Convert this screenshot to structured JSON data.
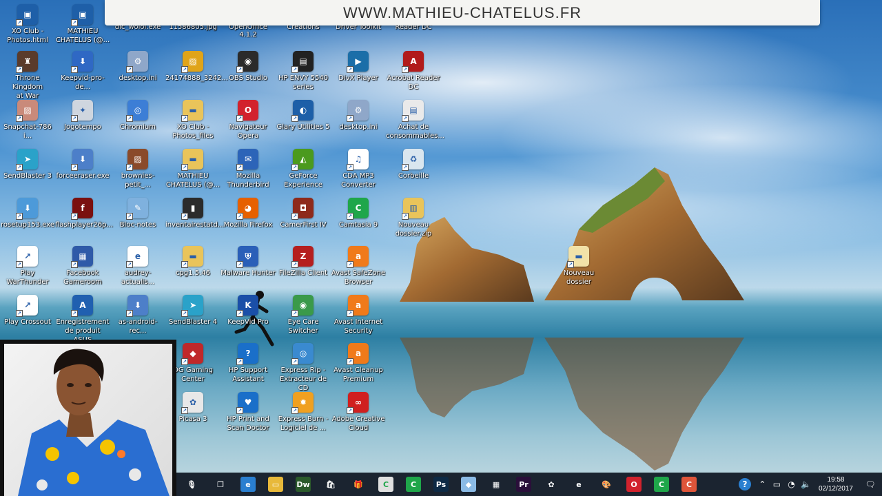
{
  "banner": {
    "text": "WWW.MATHIEU-CHATELUS.FR"
  },
  "top_partial_labels": [
    "Photos.html",
    "CHATELUS (@...",
    "dic_wolol.exe",
    "11586805.jpg",
    "OpenOffice 4.1.2",
    "Creations",
    "Driver Toolkit",
    "Reader DC"
  ],
  "desktop_icons": [
    {
      "label": "XO Club -\nPhotos.html",
      "icon": "html-file-icon",
      "color": "#1e5fa8"
    },
    {
      "label": "MATHIEU\nCHATELUS (@...",
      "icon": "html-file-icon",
      "color": "#1e5fa8"
    },
    {
      "label": "Throne Kingdom\nat War",
      "icon": "game-castle-icon",
      "color": "#5a3b2b"
    },
    {
      "label": "Keepvid-pro-de...",
      "icon": "installer-icon",
      "color": "#2f68c4"
    },
    {
      "label": "desktop.ini",
      "icon": "settings-file-icon",
      "color": "#8fa7c9"
    },
    {
      "label": "24174888_3242...",
      "icon": "image-file-icon",
      "color": "#e0a419"
    },
    {
      "label": "OBS Studio",
      "icon": "obs-icon",
      "color": "#2b2b2b"
    },
    {
      "label": "HP ENVY 5540\nseries",
      "icon": "printer-icon",
      "color": "#222"
    },
    {
      "label": "DivX Player",
      "icon": "divx-icon",
      "color": "#1b6ea8"
    },
    {
      "label": "Acrobat Reader\nDC",
      "icon": "acrobat-icon",
      "color": "#b11b1b"
    },
    {
      "label": "Snapchat-786 i...",
      "icon": "image-file-icon",
      "color": "#c98a7a"
    },
    {
      "label": "Jogotempo",
      "icon": "app-icon",
      "color": "#cfd6df"
    },
    {
      "label": "Chromium",
      "icon": "chromium-icon",
      "color": "#3c7ed6"
    },
    {
      "label": "XO Club -\nPhotos_files",
      "icon": "folder-icon",
      "color": "#e9c45a"
    },
    {
      "label": "Navigateur\nOpera",
      "icon": "opera-icon",
      "color": "#d2222d"
    },
    {
      "label": "Glary Utilities 5",
      "icon": "glary-icon",
      "color": "#1d5fa8"
    },
    {
      "label": "desktop.ini",
      "icon": "settings-file-icon",
      "color": "#8fa7c9"
    },
    {
      "label": "Achat de\nconsommables...",
      "icon": "printer-icon",
      "color": "#eaeaea"
    },
    {
      "label": "SendBlaster 3",
      "icon": "sendblaster-icon",
      "color": "#2aa2c9"
    },
    {
      "label": "forceeraser.exe",
      "icon": "installer-icon",
      "color": "#4d7fc9"
    },
    {
      "label": "brownies-petit_...",
      "icon": "image-file-icon",
      "color": "#8a4a2a"
    },
    {
      "label": "MATHIEU\nCHATELUS (@...",
      "icon": "folder-icon",
      "color": "#e9c45a"
    },
    {
      "label": "Mozilla\nThunderbird",
      "icon": "thunderbird-icon",
      "color": "#2c64b8"
    },
    {
      "label": "GeForce\nExperience",
      "icon": "nvidia-icon",
      "color": "#4b9a1e"
    },
    {
      "label": "CDA MP3\nConverter",
      "icon": "music-icon",
      "color": "#ffffff"
    },
    {
      "label": "Corbeille",
      "icon": "recycle-bin-icon",
      "color": "#d9e6ef"
    },
    {
      "label": "rosetup153.exe",
      "icon": "installer-icon",
      "color": "#4d9ad9"
    },
    {
      "label": "flashplayer26p...",
      "icon": "flash-icon",
      "color": "#7a1010"
    },
    {
      "label": "Bloc-notes",
      "icon": "notepad-icon",
      "color": "#7fb1de"
    },
    {
      "label": "inventairestatd...",
      "icon": "document-icon",
      "color": "#2b2b2b"
    },
    {
      "label": "Mozilla Firefox",
      "icon": "firefox-icon",
      "color": "#e66000"
    },
    {
      "label": "CamerFirst IV",
      "icon": "camera-icon",
      "color": "#8e2a1b"
    },
    {
      "label": "Camtasia 9",
      "icon": "camtasia-icon",
      "color": "#1fa64a"
    },
    {
      "label": "Nouveau\ndossier.zip",
      "icon": "zip-folder-icon",
      "color": "#e9c45a"
    },
    {
      "label": "Play WarThunder",
      "icon": "shortcut-file-icon",
      "color": "#ffffff"
    },
    {
      "label": "Facebook\nGameroom",
      "icon": "gameroom-icon",
      "color": "#2f5aa8"
    },
    {
      "label": "audrey-actualis...",
      "icon": "pdf-icon",
      "color": "#ffffff"
    },
    {
      "label": "cpg1.5.46",
      "icon": "folder-icon",
      "color": "#e9c45a"
    },
    {
      "label": "Malware Hunter",
      "icon": "shield-icon",
      "color": "#2a5fb8"
    },
    {
      "label": "FileZilla Client",
      "icon": "filezilla-icon",
      "color": "#b51f1f"
    },
    {
      "label": "Avast SafeZone\nBrowser",
      "icon": "avast-icon",
      "color": "#f07a1a"
    },
    {
      "label": "Nouveau dossier",
      "icon": "folder-icon",
      "color": "#f2e2a8"
    },
    {
      "label": "Play Crossout",
      "icon": "shortcut-file-icon",
      "color": "#ffffff"
    },
    {
      "label": "Enregistrement\nde produit ASUS",
      "icon": "asus-icon",
      "color": "#2060b0"
    },
    {
      "label": "as-android-rec...",
      "icon": "installer-icon",
      "color": "#4d7fc9"
    },
    {
      "label": "SendBlaster 4",
      "icon": "sendblaster-icon",
      "color": "#2aa2c9"
    },
    {
      "label": "KeepVid Pro",
      "icon": "keepvid-icon",
      "color": "#1a4fa8"
    },
    {
      "label": "Eye Care\nSwitcher",
      "icon": "eye-icon",
      "color": "#3a9a4a"
    },
    {
      "label": "Avast Internet\nSecurity",
      "icon": "avast-icon",
      "color": "#f07a1a"
    },
    {
      "label": "OG Gaming\nCenter",
      "icon": "gaming-center-icon",
      "color": "#c0282a"
    },
    {
      "label": "HP Support\nAssistant",
      "icon": "help-icon",
      "color": "#1a6fc9"
    },
    {
      "label": "Express Rip -\nExtracteur de CD",
      "icon": "cd-icon",
      "color": "#3a8ad0"
    },
    {
      "label": "Avast Cleanup\nPremium",
      "icon": "avast-icon",
      "color": "#f07a1a"
    },
    {
      "label": "Picasa 3",
      "icon": "picasa-icon",
      "color": "#e8e8e8"
    },
    {
      "label": "HP Print and\nScan Doctor",
      "icon": "hp-doctor-icon",
      "color": "#1a6fc9"
    },
    {
      "label": "Express Burn -\nLogiciel de ...",
      "icon": "burn-icon",
      "color": "#f0a020"
    },
    {
      "label": "Adobe Creative\nCloud",
      "icon": "creative-cloud-icon",
      "color": "#d01f1f"
    }
  ],
  "taskbar": {
    "apps": [
      {
        "name": "microphone-icon",
        "glyph": "🎙",
        "color": "transparent"
      },
      {
        "name": "task-view-icon",
        "glyph": "❐",
        "color": "transparent"
      },
      {
        "name": "edge-browser-icon",
        "glyph": "e",
        "color": "#2a7fd0"
      },
      {
        "name": "file-explorer-icon",
        "glyph": "▭",
        "color": "#e8b93a"
      },
      {
        "name": "dreamweaver-icon",
        "glyph": "Dw",
        "color": "#2b5a2b"
      },
      {
        "name": "store-icon",
        "glyph": "🛍",
        "color": "transparent"
      },
      {
        "name": "gift-icon",
        "glyph": "🎁",
        "color": "transparent"
      },
      {
        "name": "camtasia-recorder-icon",
        "glyph": "C",
        "color": "#e0e0e0"
      },
      {
        "name": "camtasia-icon",
        "glyph": "C",
        "color": "#1fa64a"
      },
      {
        "name": "photoshop-icon",
        "glyph": "Ps",
        "color": "#0e2a45"
      },
      {
        "name": "eraser-icon",
        "glyph": "◆",
        "color": "#8bbbe6"
      },
      {
        "name": "calculator-icon",
        "glyph": "▦",
        "color": "transparent"
      },
      {
        "name": "premiere-icon",
        "glyph": "Pr",
        "color": "#2a0f3a"
      },
      {
        "name": "picasa-icon",
        "glyph": "✿",
        "color": "transparent"
      },
      {
        "name": "internet-explorer-icon",
        "glyph": "e",
        "color": "transparent"
      },
      {
        "name": "paint-icon",
        "glyph": "🎨",
        "color": "transparent"
      },
      {
        "name": "opera-icon",
        "glyph": "O",
        "color": "#d2222d"
      },
      {
        "name": "camtasia-9-icon",
        "glyph": "C",
        "color": "#1fa64a"
      },
      {
        "name": "camtasia-red-icon",
        "glyph": "C",
        "color": "#e0553a"
      }
    ],
    "tray": [
      {
        "name": "help-tray-icon",
        "glyph": "?"
      },
      {
        "name": "chevron-up-icon",
        "glyph": "⌃"
      },
      {
        "name": "battery-icon",
        "glyph": "▭"
      },
      {
        "name": "wifi-icon",
        "glyph": "◔"
      },
      {
        "name": "volume-icon",
        "glyph": "🔈"
      }
    ],
    "clock": {
      "time": "19:58",
      "date": "02/12/2017"
    },
    "notification_glyph": "🗨"
  },
  "colors": {
    "taskbar_bg": "#1b2430",
    "banner_bg": "#f4f4f2",
    "banner_text": "#333333"
  }
}
